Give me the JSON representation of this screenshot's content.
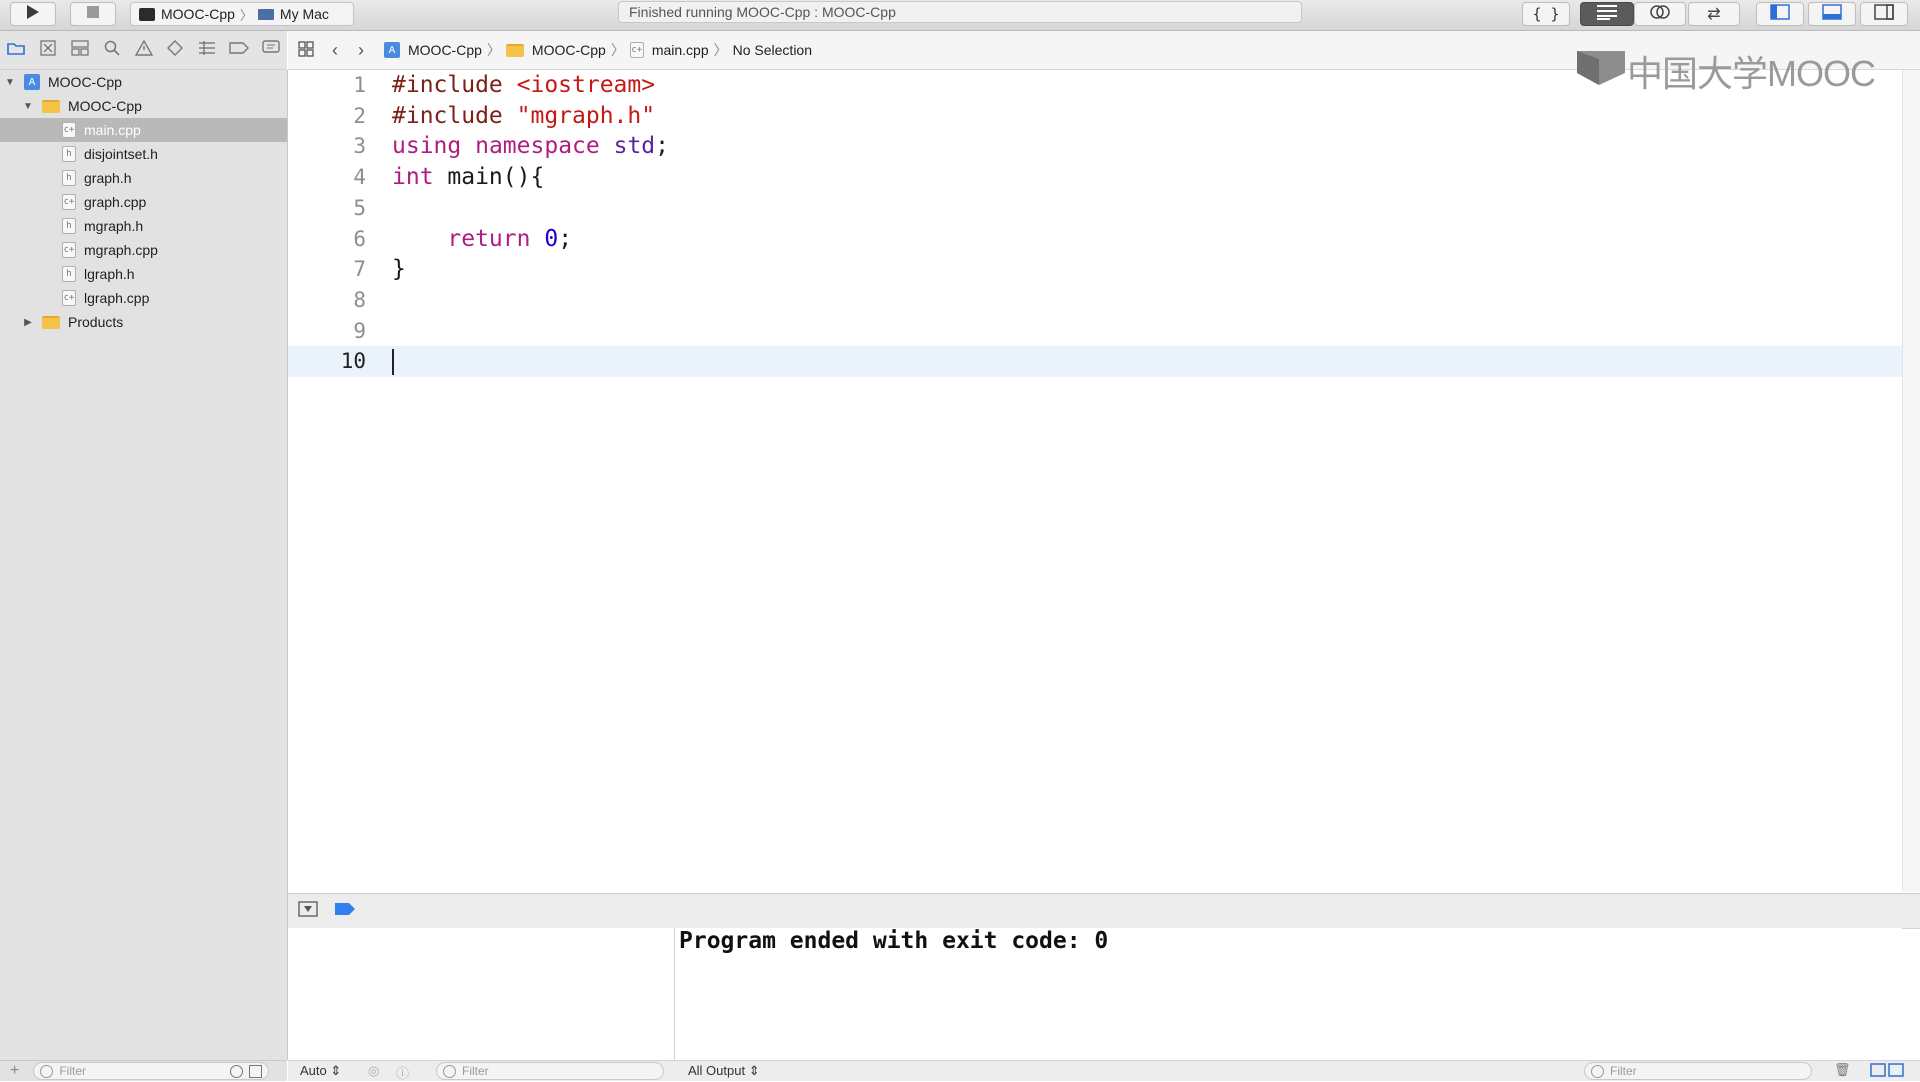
{
  "toolbar": {
    "run_icon": "play-icon",
    "stop_icon": "stop-icon",
    "scheme": "MOOC-Cpp",
    "destination": "My Mac",
    "status": "Finished running MOOC-Cpp : MOOC-Cpp",
    "right_icons": [
      "braces-icon",
      "standard-editor-icon",
      "assistant-editor-icon",
      "version-editor-icon",
      "left-panel-icon",
      "bottom-panel-icon",
      "right-panel-icon"
    ]
  },
  "navigator": {
    "tab_icons": [
      "folder-icon",
      "source-control-icon",
      "symbol-icon",
      "search-icon",
      "warning-icon",
      "test-icon",
      "debug-icon",
      "breakpoint-icon",
      "report-icon"
    ],
    "project": "MOOC-Cpp",
    "group": "MOOC-Cpp",
    "files": [
      {
        "name": "main.cpp",
        "type": "c++"
      },
      {
        "name": "disjointset.h",
        "type": "h"
      },
      {
        "name": "graph.h",
        "type": "h"
      },
      {
        "name": "graph.cpp",
        "type": "c++"
      },
      {
        "name": "mgraph.h",
        "type": "h"
      },
      {
        "name": "mgraph.cpp",
        "type": "c++"
      },
      {
        "name": "lgraph.h",
        "type": "h"
      },
      {
        "name": "lgraph.cpp",
        "type": "c++"
      }
    ],
    "products": "Products",
    "filter_placeholder": "Filter"
  },
  "jumpbar": {
    "project": "MOOC-Cpp",
    "group": "MOOC-Cpp",
    "file": "main.cpp",
    "selection": "No Selection"
  },
  "editor": {
    "lines": [
      {
        "n": "1",
        "tokens": [
          [
            "pre",
            "#include "
          ],
          [
            "str",
            "<iostream>"
          ]
        ]
      },
      {
        "n": "2",
        "tokens": [
          [
            "pre",
            "#include "
          ],
          [
            "str",
            "\"mgraph.h\""
          ]
        ]
      },
      {
        "n": "3",
        "tokens": [
          [
            "kw",
            "using"
          ],
          [
            "plain",
            " "
          ],
          [
            "kw",
            "namespace"
          ],
          [
            "plain",
            " "
          ],
          [
            "std",
            "std"
          ],
          [
            "plain",
            ";"
          ]
        ]
      },
      {
        "n": "4",
        "tokens": [
          [
            "kw",
            "int"
          ],
          [
            "plain",
            " main(){"
          ]
        ]
      },
      {
        "n": "5",
        "tokens": []
      },
      {
        "n": "6",
        "tokens": [
          [
            "plain",
            "    "
          ],
          [
            "kw",
            "return"
          ],
          [
            "plain",
            " "
          ],
          [
            "num",
            "0"
          ],
          [
            "plain",
            ";"
          ]
        ]
      },
      {
        "n": "7",
        "tokens": [
          [
            "plain",
            "}"
          ]
        ]
      },
      {
        "n": "8",
        "tokens": []
      },
      {
        "n": "9",
        "tokens": []
      },
      {
        "n": "10",
        "tokens": [],
        "current": true
      }
    ],
    "colors": {
      "preprocessor": "#7b2118",
      "string": "#c41a16",
      "keyword": "#b01d82",
      "type": "#5b2699",
      "number": "#1c00cf"
    }
  },
  "watermark": {
    "text": "中国大学MOOC"
  },
  "debug": {
    "console_output": "Program ended with exit code: 0",
    "auto_label": "Auto",
    "filter_placeholder": "Filter",
    "output_selector": "All Output",
    "console_filter_placeholder": "Filter"
  }
}
